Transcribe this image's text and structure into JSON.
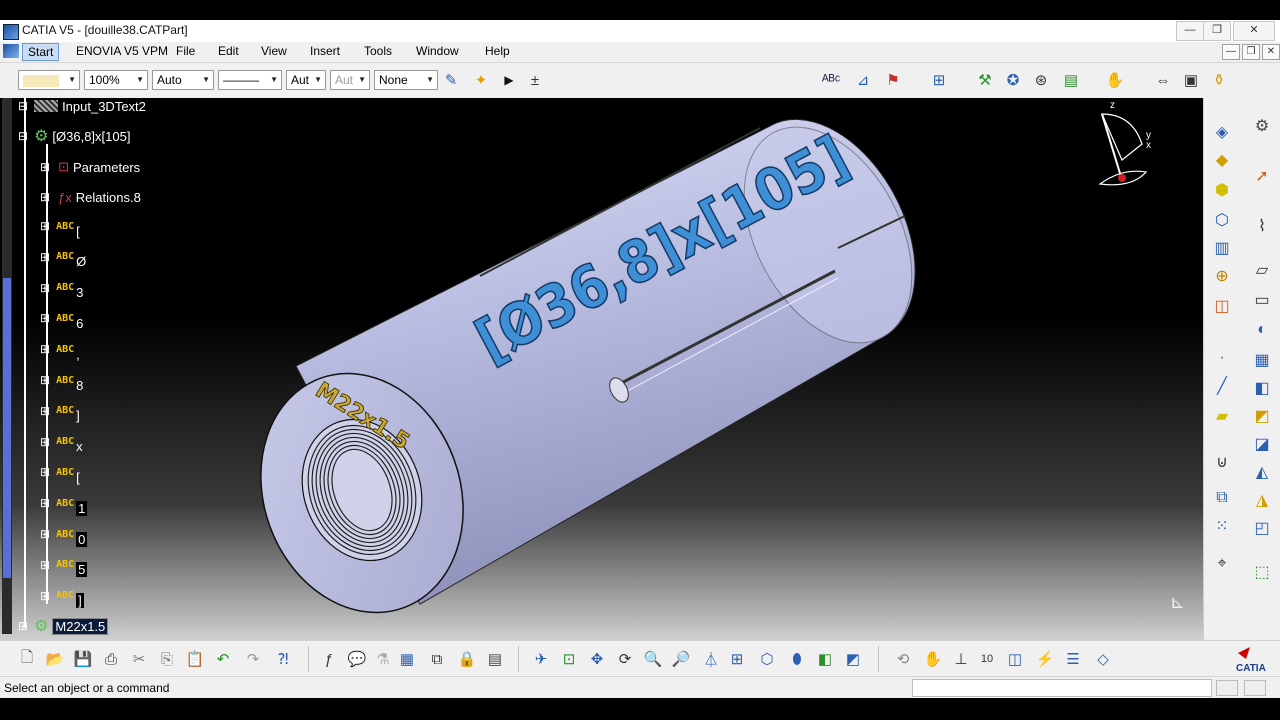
{
  "window": {
    "title": "CATIA V5 - [douille38.CATPart]",
    "minimize_glyph": "—",
    "restore_glyph": "❐",
    "close_glyph": "✕"
  },
  "menu": {
    "items": [
      "Start",
      "ENOVIA V5 VPM",
      "File",
      "Edit",
      "View",
      "Insert",
      "Tools",
      "Window",
      "Help"
    ]
  },
  "toolbar": {
    "color_value": "",
    "transparency_value": "100%",
    "thickness_value": "Auto",
    "linetype_value": "———",
    "point_value": "Aut",
    "layer_value": "Aut",
    "rendering_value": "None"
  },
  "tree": {
    "header_label": "Input_3DText2",
    "part_label": "[Ø36,8]x[105]",
    "parameters_label": "Parameters",
    "relations_label": "Relations.8",
    "abc_tag": "ABC",
    "text_items": [
      "[",
      "Ø",
      "3",
      "6",
      ",",
      "8",
      "]",
      "x",
      "[",
      "1",
      "0",
      "5",
      "]"
    ],
    "bottom_label": "M22x1.5"
  },
  "model": {
    "engraved_text": "[Ø36,8]x[105]",
    "end_text": "M22x1.5",
    "body_color": "#b8bce0",
    "engraving_color": "#3e8fd6",
    "end_text_color": "#c9a830"
  },
  "compass": {
    "z_label": "z",
    "y_label": "y",
    "x_label": "x"
  },
  "status": {
    "message": "Select an object or a command"
  },
  "colors": {
    "menu_bg": "#f0f0f0",
    "viewport_bg": "#000000",
    "abc_yellow": "#f5c400",
    "tree_text": "#ffffff"
  }
}
